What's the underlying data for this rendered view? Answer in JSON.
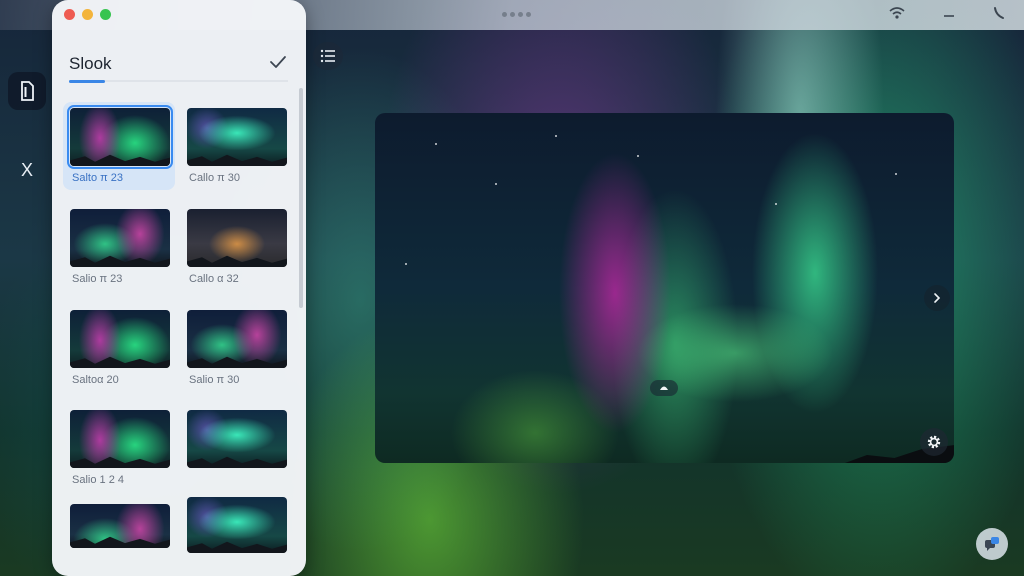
{
  "window": {
    "traffic_lights": [
      "#ee5b52",
      "#f3b43c",
      "#37c450"
    ]
  },
  "topbar": {
    "icons": [
      "handle-dots",
      "wifi-icon",
      "minimize-icon",
      "phone-icon"
    ]
  },
  "dock": {
    "items": [
      {
        "name": "document-icon",
        "label": "",
        "active": true
      },
      {
        "name": "x-icon",
        "label": "X",
        "active": false
      }
    ]
  },
  "sidebar": {
    "title": "Slook",
    "confirm_icon": "checkmark-icon",
    "accent": "#3a86e6",
    "thumbnails": [
      {
        "label": "Salto π 23",
        "selected": true
      },
      {
        "label": "Callo π 30",
        "selected": false
      },
      {
        "label": "Salio π 23",
        "selected": false
      },
      {
        "label": "Callo α 32",
        "selected": false
      },
      {
        "label": "Saltoα 20",
        "selected": false
      },
      {
        "label": "Salio π 30",
        "selected": false
      },
      {
        "label": "Salio 1 2 4",
        "selected": false
      },
      {
        "label": "",
        "selected": false
      },
      {
        "label": "",
        "selected": false
      },
      {
        "label": "",
        "selected": false
      }
    ]
  },
  "toolbar": {
    "list_icon": "list-icon"
  },
  "viewer": {
    "next_icon": "chevron-right-icon",
    "center_icon": "eject-icon",
    "settings_icon": "gear-icon"
  },
  "corner": {
    "chat_icon": "chat-icon"
  }
}
